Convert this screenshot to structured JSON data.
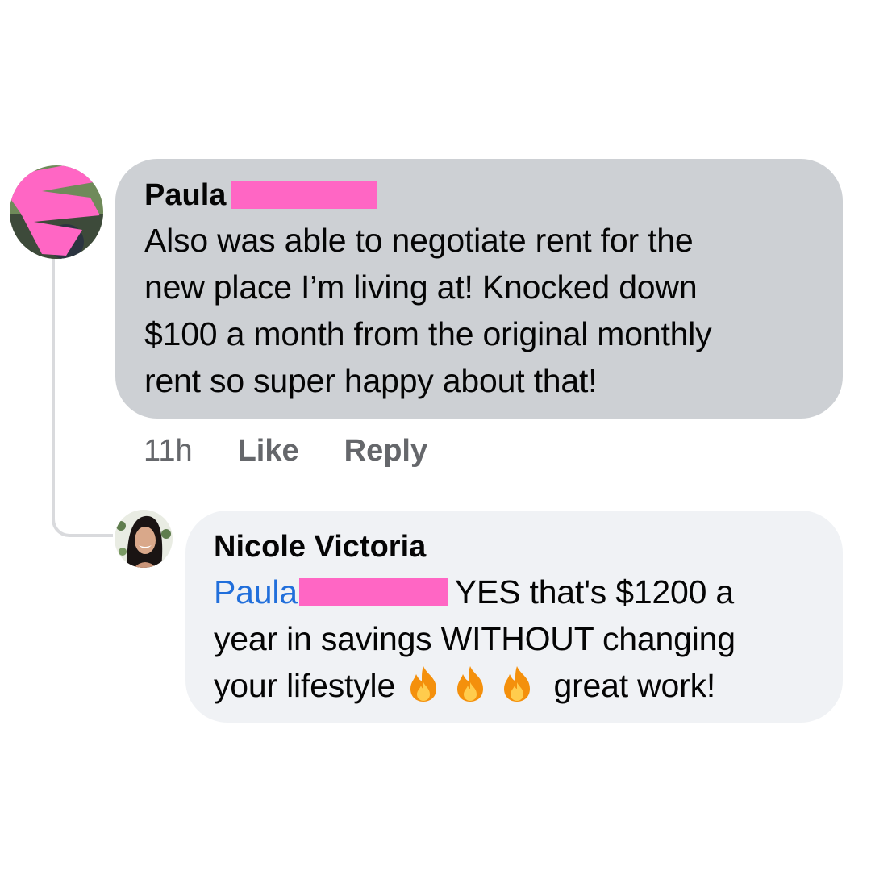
{
  "comment": {
    "author": "Paula",
    "text_lines": [
      "Also was able to negotiate rent for the",
      "new place I’m living at! Knocked down",
      "$100 a month from the original monthly",
      "rent so super happy about that!"
    ],
    "time": "11h",
    "like_label": "Like",
    "reply_label": "Reply"
  },
  "reply": {
    "author": "Nicole Victoria",
    "mention": "Paula",
    "line1_after_mention": "YES that's $1200 a",
    "line2": "year in savings WITHOUT changing",
    "line3_before_emoji": "your lifestyle",
    "line3_after_emoji": "great work!"
  },
  "colors": {
    "redaction": "#ff66c4",
    "mention": "#216fdb",
    "bubble_comment": "#cdd0d4",
    "bubble_reply": "#f0f2f5",
    "meta_text": "#65676b"
  },
  "icons": {
    "avatar_1": "avatar-redacted",
    "avatar_2": "avatar-photo",
    "emoji": "fire-emoji"
  }
}
